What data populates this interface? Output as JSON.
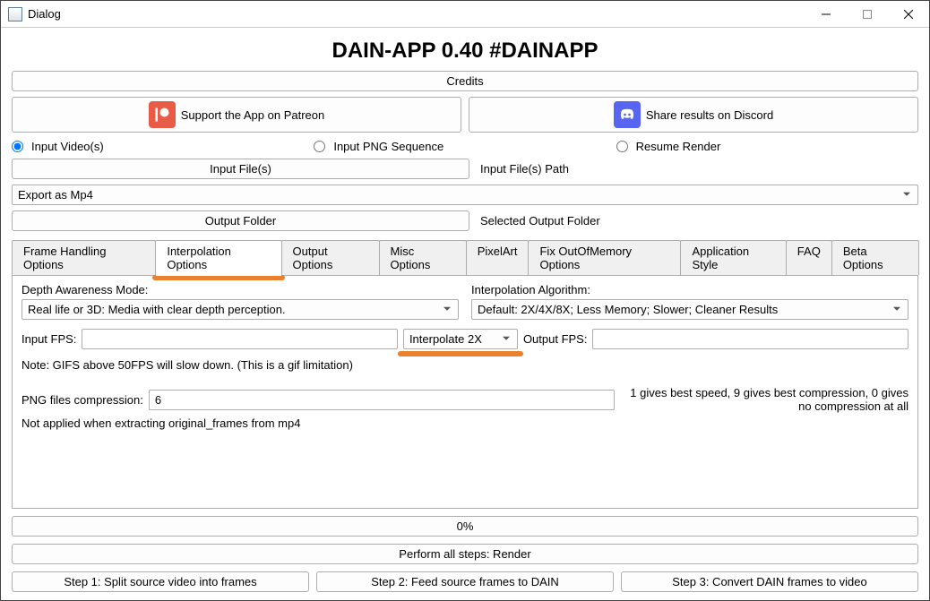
{
  "window": {
    "title": "Dialog"
  },
  "header": {
    "title": "DAIN-APP 0.40 #DAINAPP"
  },
  "buttons": {
    "credits": "Credits",
    "patreon": "Support the App on Patreon",
    "discord": "Share results on Discord",
    "input_files": "Input File(s)",
    "output_folder": "Output Folder",
    "perform_all": "Perform all steps: Render",
    "step1": "Step 1: Split source video into frames",
    "step2": "Step 2: Feed source frames to DAIN",
    "step3": "Step 3: Convert DAIN frames to video"
  },
  "radios": {
    "input_videos": "Input Video(s)",
    "input_png": "Input PNG Sequence",
    "resume": "Resume Render"
  },
  "labels": {
    "input_files_path": "Input File(s) Path",
    "selected_output_folder": "Selected Output Folder",
    "depth_mode": "Depth Awareness Mode:",
    "interp_algo": "Interpolation Algorithm:",
    "input_fps": "Input FPS:",
    "output_fps": "Output FPS:",
    "note_gif": "Note: GIFS above 50FPS will slow down. (This is a gif limitation)",
    "png_comp": "PNG files compression:",
    "png_hint": "1 gives best speed, 9 gives best compression, 0 gives no compression at all",
    "png_note": "Not applied when extracting original_frames from mp4"
  },
  "selects": {
    "export": "Export as Mp4",
    "depth_mode": "Real life or 3D: Media with clear depth perception.",
    "interp_algo": "Default: 2X/4X/8X; Less Memory; Slower; Cleaner Results",
    "interp_mult": "Interpolate 2X"
  },
  "inputs": {
    "input_fps": "",
    "output_fps": "",
    "png_compression": "6"
  },
  "tabs": [
    "Frame Handling Options",
    "Interpolation Options",
    "Output Options",
    "Misc Options",
    "PixelArt",
    "Fix OutOfMemory Options",
    "Application Style",
    "FAQ",
    "Beta Options"
  ],
  "active_tab_index": 1,
  "progress": {
    "label": "0%"
  }
}
